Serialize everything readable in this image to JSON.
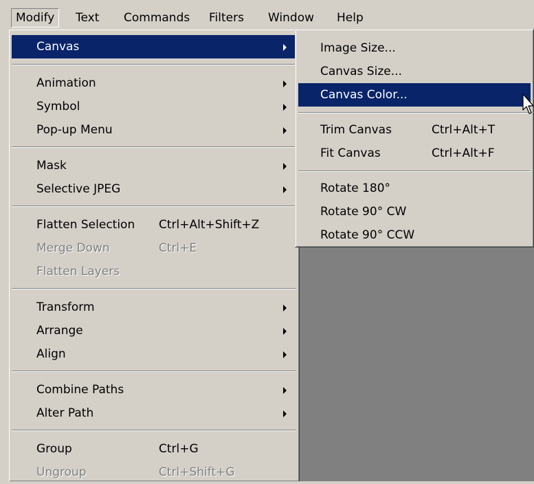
{
  "menubar": {
    "items": [
      {
        "label": "Modify"
      },
      {
        "label": "Text"
      },
      {
        "label": "Commands"
      },
      {
        "label": "Filters"
      },
      {
        "label": "Window"
      },
      {
        "label": "Help"
      }
    ]
  },
  "modify_menu": {
    "canvas": {
      "label": "Canvas"
    },
    "animation": {
      "label": "Animation"
    },
    "symbol": {
      "label": "Symbol"
    },
    "popup_menu": {
      "label": "Pop-up Menu"
    },
    "mask": {
      "label": "Mask"
    },
    "selective_jpeg": {
      "label": "Selective JPEG"
    },
    "flatten_selection": {
      "label": "Flatten Selection",
      "shortcut": "Ctrl+Alt+Shift+Z"
    },
    "merge_down": {
      "label": "Merge Down",
      "shortcut": "Ctrl+E"
    },
    "flatten_layers": {
      "label": "Flatten Layers"
    },
    "transform": {
      "label": "Transform"
    },
    "arrange": {
      "label": "Arrange"
    },
    "align": {
      "label": "Align"
    },
    "combine_paths": {
      "label": "Combine Paths"
    },
    "alter_path": {
      "label": "Alter Path"
    },
    "group": {
      "label": "Group",
      "shortcut": "Ctrl+G"
    },
    "ungroup": {
      "label": "Ungroup",
      "shortcut": "Ctrl+Shift+G"
    }
  },
  "canvas_submenu": {
    "image_size": {
      "label": "Image Size..."
    },
    "canvas_size": {
      "label": "Canvas Size..."
    },
    "canvas_color": {
      "label": "Canvas Color..."
    },
    "trim_canvas": {
      "label": "Trim Canvas",
      "shortcut": "Ctrl+Alt+T"
    },
    "fit_canvas": {
      "label": "Fit Canvas",
      "shortcut": "Ctrl+Alt+F"
    },
    "rotate_180": {
      "label": "Rotate 180°"
    },
    "rotate_90_cw": {
      "label": "Rotate 90° CW"
    },
    "rotate_90_ccw": {
      "label": "Rotate 90° CCW"
    }
  },
  "colors": {
    "menu_bg": "#D4D0C8",
    "highlight": "#0A246A",
    "canvas_bg": "#808080",
    "disabled_text": "#808080"
  },
  "icons": {
    "cursor": "arrow-pointer-icon",
    "submenu": "submenu-arrow-icon"
  }
}
